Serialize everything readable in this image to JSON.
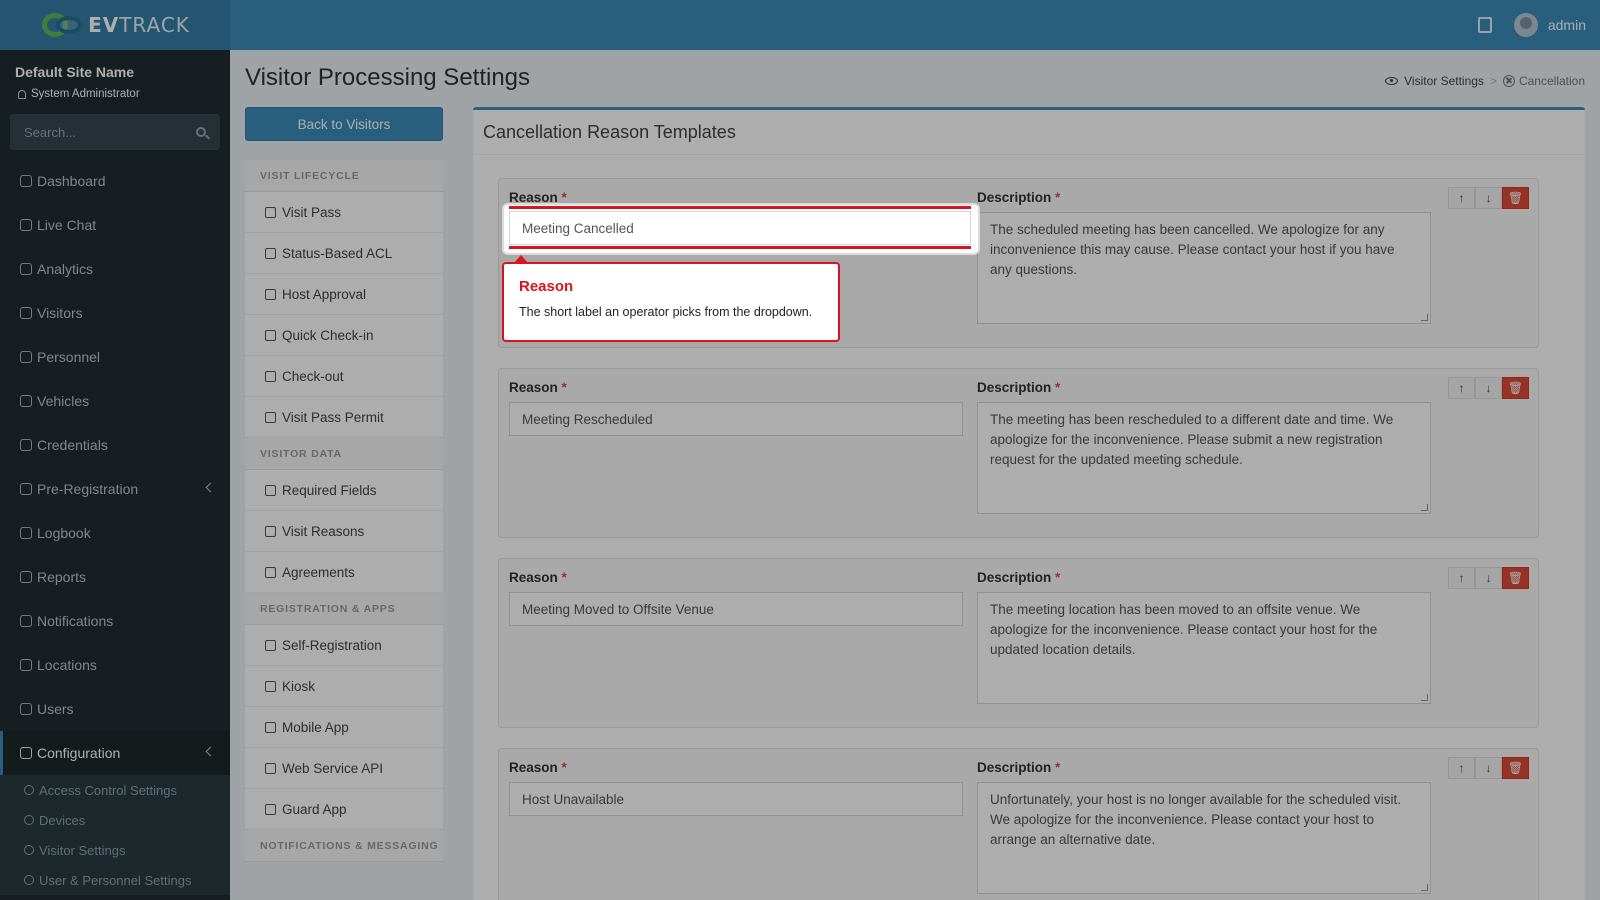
{
  "brand": {
    "logo_text_bold": "EV",
    "logo_text_rest": "TRACK"
  },
  "header": {
    "user_name": "admin"
  },
  "sidebar": {
    "site_name": "Default Site Name",
    "role": "System Administrator",
    "search_placeholder": "Search...",
    "items": [
      {
        "label": "Dashboard",
        "icon": "dashboard-icon"
      },
      {
        "label": "Live Chat",
        "icon": "headset-icon"
      },
      {
        "label": "Analytics",
        "icon": "analytics-icon"
      },
      {
        "label": "Visitors",
        "icon": "eye-icon"
      },
      {
        "label": "Personnel",
        "icon": "personnel-icon"
      },
      {
        "label": "Vehicles",
        "icon": "car-icon"
      },
      {
        "label": "Credentials",
        "icon": "credentials-icon"
      },
      {
        "label": "Pre-Registration",
        "icon": "swap-icon"
      },
      {
        "label": "Logbook",
        "icon": "book-icon"
      },
      {
        "label": "Reports",
        "icon": "reports-icon"
      },
      {
        "label": "Notifications",
        "icon": "bell-icon"
      },
      {
        "label": "Locations",
        "icon": "map-icon"
      },
      {
        "label": "Users",
        "icon": "users-icon"
      },
      {
        "label": "Configuration",
        "icon": "gear-icon"
      }
    ],
    "sub_items": [
      {
        "label": "Access Control Settings",
        "icon": "lock-icon"
      },
      {
        "label": "Devices",
        "icon": "devices-icon"
      },
      {
        "label": "Visitor Settings",
        "icon": "eye-icon"
      },
      {
        "label": "User & Personnel Settings",
        "icon": "user-settings-icon"
      }
    ]
  },
  "page": {
    "title": "Visitor Processing Settings",
    "breadcrumb": {
      "parent": "Visitor Settings",
      "separator": ">",
      "current": "Cancellation"
    },
    "back_button": "Back to Visitors"
  },
  "settings_menu": {
    "sections": [
      {
        "title": "VISIT LIFECYCLE",
        "items": [
          "Visit Pass",
          "Status-Based ACL",
          "Host Approval",
          "Quick Check-in",
          "Check-out",
          "Visit Pass Permit"
        ]
      },
      {
        "title": "VISITOR DATA",
        "items": [
          "Required Fields",
          "Visit Reasons",
          "Agreements"
        ]
      },
      {
        "title": "REGISTRATION & APPS",
        "items": [
          "Self-Registration",
          "Kiosk",
          "Mobile App",
          "Web Service API",
          "Guard App"
        ]
      },
      {
        "title": "NOTIFICATIONS & MESSAGING",
        "items": []
      }
    ]
  },
  "main": {
    "box_title": "Cancellation Reason Templates",
    "reason_label": "Reason",
    "description_label": "Description",
    "required_mark": "*",
    "templates": [
      {
        "reason": "Meeting Cancelled",
        "description": "The scheduled meeting has been cancelled. We apologize for any inconvenience this may cause. Please contact your host if you have any questions."
      },
      {
        "reason": "Meeting Rescheduled",
        "description": "The meeting has been rescheduled to a different date and time. We apologize for the inconvenience. Please submit a new registration request for the updated meeting schedule."
      },
      {
        "reason": "Meeting Moved to Offsite Venue",
        "description": "The meeting location has been moved to an offsite venue. We apologize for the inconvenience. Please contact your host for the updated location details."
      },
      {
        "reason": "Host Unavailable",
        "description": "Unfortunately, your host is no longer available for the scheduled visit. We apologize for the inconvenience. Please contact your host to arrange an alternative date."
      }
    ],
    "action_icons": {
      "up": "↑",
      "down": "↓",
      "delete": "🗑"
    }
  },
  "tooltip": {
    "title": "Reason",
    "body": "The short label an operator picks from the dropdown."
  },
  "colors": {
    "header": "#3c8dbc",
    "sidebar": "#222d32",
    "highlight": "#d9141f",
    "danger": "#dd4b39"
  }
}
